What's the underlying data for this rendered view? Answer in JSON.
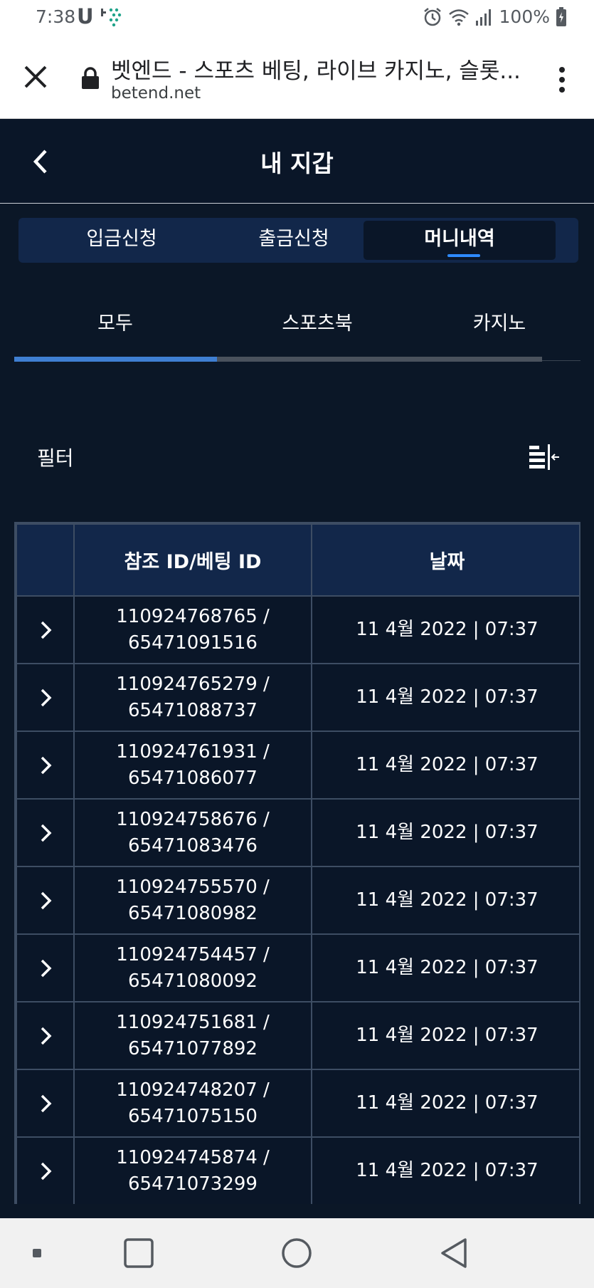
{
  "status_bar": {
    "time": "7:38",
    "carrier": "U",
    "battery": "100%"
  },
  "browser": {
    "title": "벳엔드 - 스포츠 베팅, 라이브 카지노, 슬롯...",
    "url": "betend.net"
  },
  "header": {
    "title": "내 지갑"
  },
  "main_tabs": [
    {
      "label": "입금신청"
    },
    {
      "label": "출금신청"
    },
    {
      "label": "머니내역"
    }
  ],
  "sub_tabs": [
    {
      "label": "모두"
    },
    {
      "label": "스포츠북"
    },
    {
      "label": "카지노"
    }
  ],
  "filter": {
    "label": "필터"
  },
  "table": {
    "headers": [
      "",
      "참조 ID/베팅 ID",
      "날짜"
    ],
    "rows": [
      {
        "ref_id": "110924768765 /",
        "bet_id": "65471091516",
        "date": "11 4월 2022 | 07:37"
      },
      {
        "ref_id": "110924765279 /",
        "bet_id": "65471088737",
        "date": "11 4월 2022 | 07:37"
      },
      {
        "ref_id": "110924761931 /",
        "bet_id": "65471086077",
        "date": "11 4월 2022 | 07:37"
      },
      {
        "ref_id": "110924758676 /",
        "bet_id": "65471083476",
        "date": "11 4월 2022 | 07:37"
      },
      {
        "ref_id": "110924755570 /",
        "bet_id": "65471080982",
        "date": "11 4월 2022 | 07:37"
      },
      {
        "ref_id": "110924754457 /",
        "bet_id": "65471080092",
        "date": "11 4월 2022 | 07:37"
      },
      {
        "ref_id": "110924751681 /",
        "bet_id": "65471077892",
        "date": "11 4월 2022 | 07:37"
      },
      {
        "ref_id": "110924748207 /",
        "bet_id": "65471075150",
        "date": "11 4월 2022 | 07:37"
      },
      {
        "ref_id": "110924745874 /",
        "bet_id": "65471073299",
        "date": "11 4월 2022 | 07:37"
      }
    ]
  },
  "colors": {
    "background": "#0b1727",
    "header_bg": "#0a1628",
    "tab_bar_bg": "#12274a",
    "accent": "#2e8bff",
    "progress": "#3f7fd2",
    "border": "#3d4d63"
  },
  "icons": {
    "close": "close-icon",
    "lock": "lock-icon",
    "menu": "more-vert-icon",
    "back": "chevron-left-icon",
    "filter": "filter-collapse-icon",
    "row_expand": "chevron-right-icon"
  }
}
